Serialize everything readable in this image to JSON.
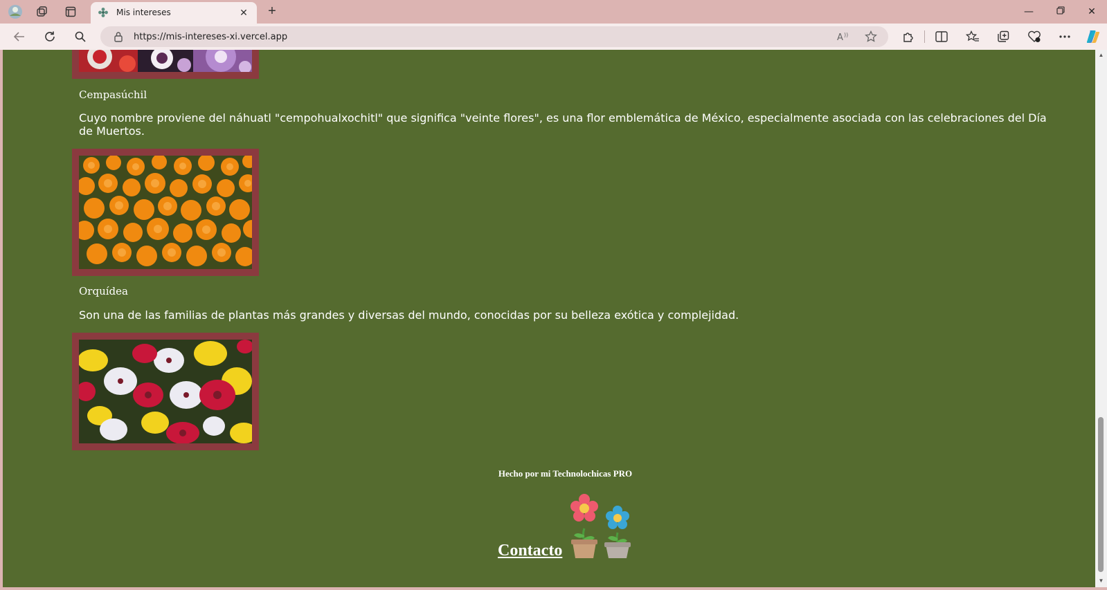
{
  "browser": {
    "tab_title": "Mis intereses",
    "url": "https://mis-intereses-xi.vercel.app"
  },
  "page": {
    "flowers": [
      {
        "name": "Cempasúchil",
        "description": "Cuyo nombre proviene del náhuatl \"cempohualxochitl\" que significa \"veinte flores\", es una flor emblemática de México, especialmente asociada con las celebraciones del Día de Muertos."
      },
      {
        "name": "Orquídea",
        "description": "Son una de las familias de plantas más grandes y diversas del mundo, conocidas por su belleza exótica y complejidad."
      }
    ],
    "footer": "Hecho por mi Technolochicas PRO",
    "contact_link": "Contacto"
  },
  "colors": {
    "page_background": "#556b2f",
    "image_frame": "#8b3a3f",
    "browser_chrome": "#dcb4b2"
  },
  "icons": [
    "profile-icon",
    "workspaces-icon",
    "tab-actions-icon",
    "tab-favicon-icon",
    "close-tab-icon",
    "new-tab-icon",
    "minimize-icon",
    "restore-icon",
    "close-window-icon",
    "back-icon",
    "refresh-icon",
    "search-icon",
    "lock-icon",
    "read-aloud-icon",
    "favorite-star-icon",
    "extensions-icon",
    "split-screen-icon",
    "favorites-icon",
    "collections-icon",
    "browser-essentials-icon",
    "more-icon",
    "copilot-icon",
    "flower-pots-icon"
  ]
}
